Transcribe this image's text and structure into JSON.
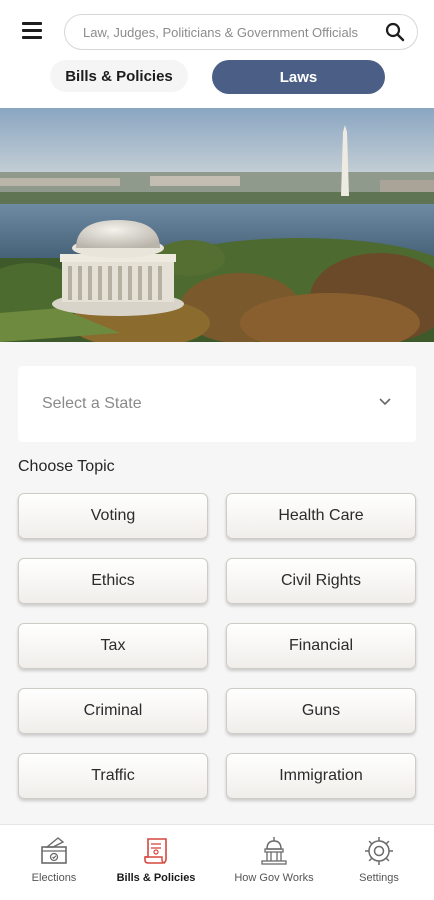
{
  "search": {
    "placeholder": "Law, Judges, Politicians & Government Officials"
  },
  "tabs": [
    {
      "label": "Bills & Policies",
      "active": false
    },
    {
      "label": "Laws",
      "active": true
    }
  ],
  "hero_image": {
    "subject": "Jefferson Memorial and Washington Monument aerial view"
  },
  "state_select": {
    "value": "Select a State"
  },
  "topic_heading": "Choose Topic",
  "topics": [
    "Voting",
    "Health Care",
    "Ethics",
    "Civil Rights",
    "Tax",
    "Financial",
    "Criminal",
    "Guns",
    "Traffic",
    "Immigration"
  ],
  "bottom_nav": [
    {
      "label": "Elections",
      "icon": "ballot-box-icon",
      "active": false
    },
    {
      "label": "Bills & Policies",
      "icon": "document-scroll-icon",
      "active": true
    },
    {
      "label": "How Gov Works",
      "icon": "capitol-icon",
      "active": false
    },
    {
      "label": "Settings",
      "icon": "gear-icon",
      "active": false
    }
  ],
  "colors": {
    "accent": "#4b5f86",
    "active_nav": "#d6473f",
    "background": "#f6f6f6"
  }
}
